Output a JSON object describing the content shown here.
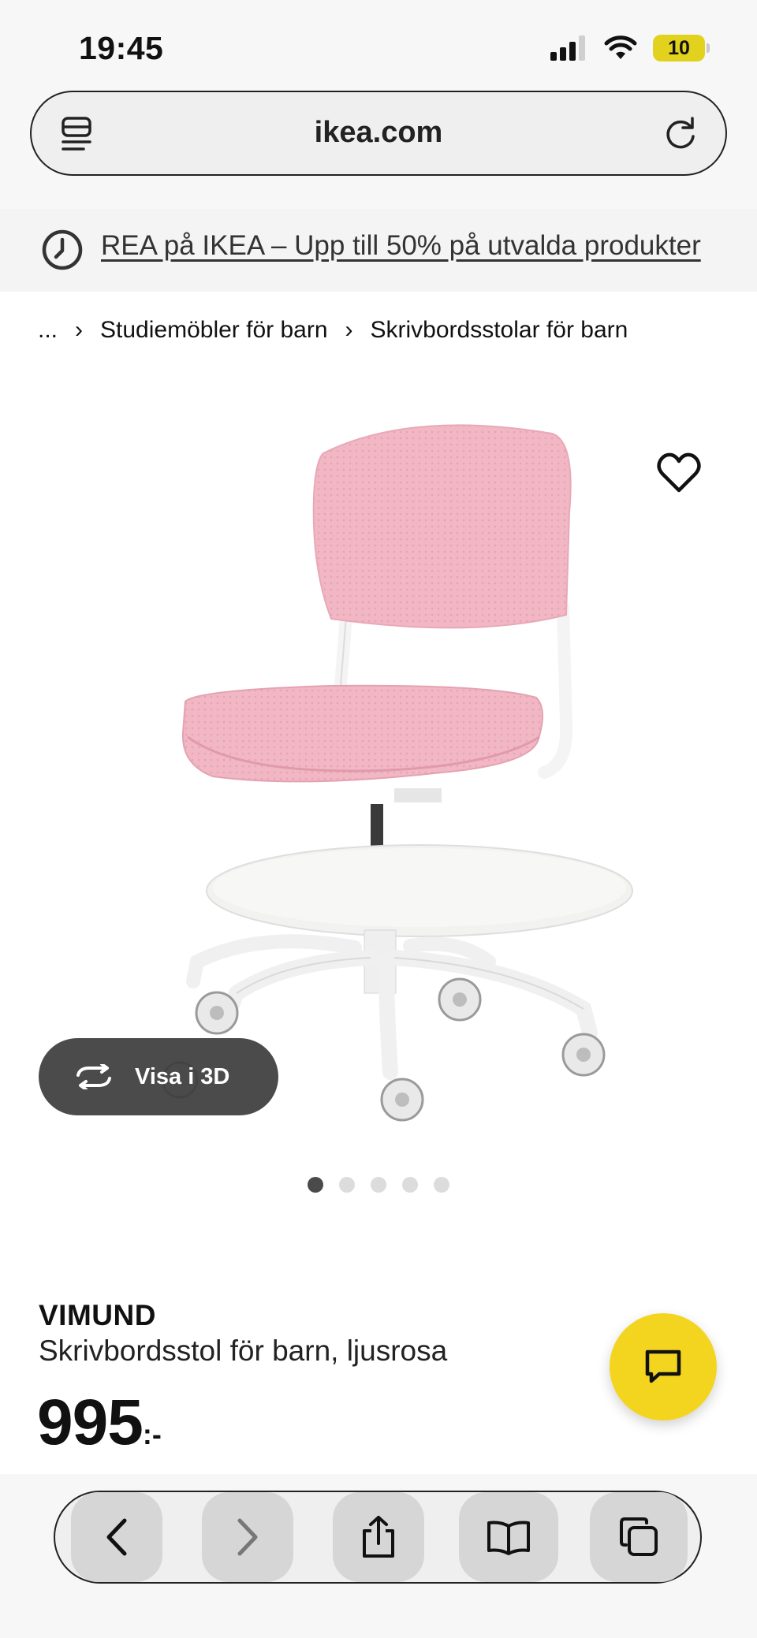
{
  "status_bar": {
    "time": "19:45",
    "battery": "10",
    "icons": [
      "cellular-signal-icon",
      "wifi-icon",
      "battery-icon"
    ]
  },
  "browser": {
    "url": "ikea.com",
    "icons": [
      "reader-menu-icon",
      "reload-icon"
    ]
  },
  "promo": {
    "text": "REA på IKEA – Upp till 50% på utvalda produkter",
    "icon": "clock-icon"
  },
  "breadcrumb": {
    "ellipsis": "...",
    "items": [
      "Studiemöbler för barn",
      "Skrivbordsstolar för barn"
    ],
    "separator": "›"
  },
  "gallery": {
    "view_3d_label": "Visa i 3D",
    "image_count": 5,
    "active_index": 0
  },
  "product": {
    "name": "VIMUND",
    "description": "Skrivbordsstol för barn, ljusrosa",
    "price": "995",
    "price_suffix": ":-"
  },
  "colors": {
    "chat_button": "#f3d520",
    "chair_pink": "#f2b7c4",
    "view3d_bg": "#3c3c3c",
    "battery": "#e2d21e"
  },
  "toolbar": {
    "items": [
      "back-icon",
      "forward-icon",
      "share-icon",
      "bookmarks-icon",
      "tabs-icon"
    ]
  }
}
